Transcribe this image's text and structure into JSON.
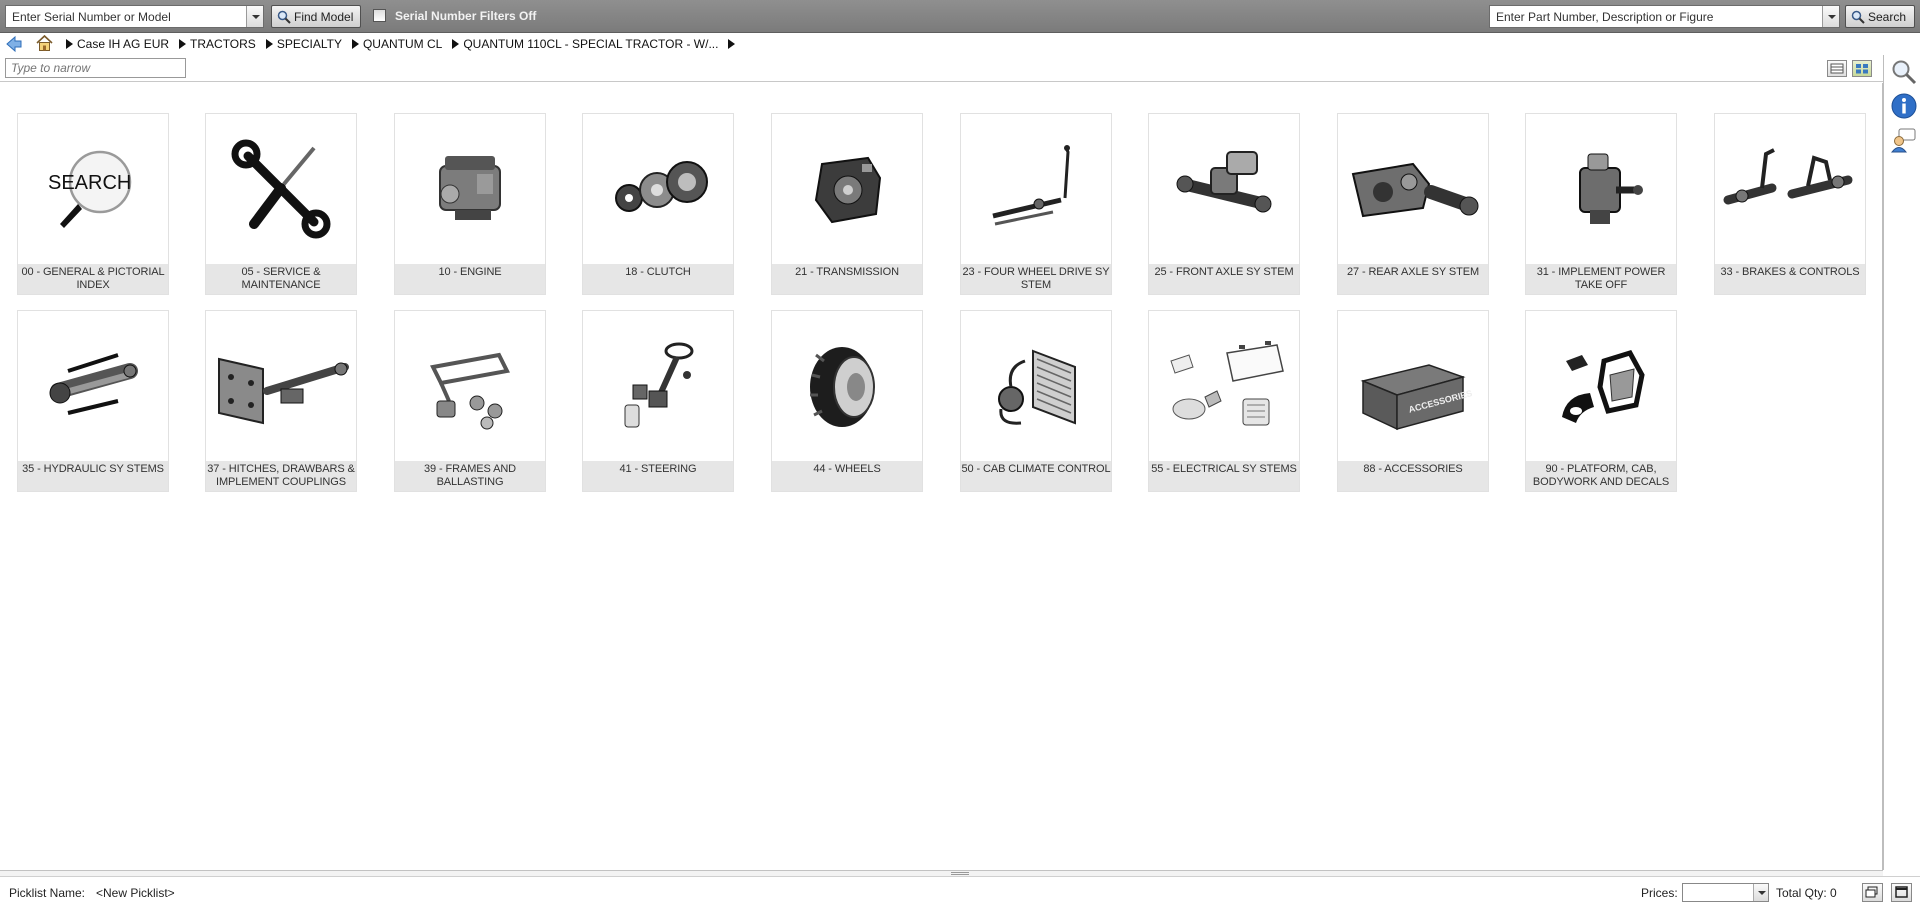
{
  "toolbar": {
    "serial_placeholder": "Enter Serial Number or Model",
    "find_model_label": "Find Model",
    "serial_filter_label": "Serial Number Filters Off",
    "part_placeholder": "Enter Part Number, Description or Figure",
    "search_label": "Search"
  },
  "breadcrumb": [
    "Case IH AG EUR",
    "TRACTORS",
    "SPECIALTY",
    "QUANTUM CL",
    "QUANTUM 110CL - SPECIAL TRACTOR - W/..."
  ],
  "narrow": {
    "placeholder": "Type to narrow"
  },
  "categories": [
    {
      "label": "00 - GENERAL & PICTORIAL INDEX",
      "icon": "search-magnifier-icon"
    },
    {
      "label": "05 - SERVICE & MAINTENANCE",
      "icon": "wrench-screwdriver-icon"
    },
    {
      "label": "10 - ENGINE",
      "icon": "engine-icon"
    },
    {
      "label": "18 - CLUTCH",
      "icon": "clutch-icon"
    },
    {
      "label": "21 - TRANSMISSION",
      "icon": "transmission-icon"
    },
    {
      "label": "23 - FOUR WHEEL DRIVE SY STEM",
      "icon": "four-wheel-drive-icon"
    },
    {
      "label": "25 - FRONT AXLE SY STEM",
      "icon": "front-axle-icon"
    },
    {
      "label": "27 - REAR AXLE SY STEM",
      "icon": "rear-axle-icon"
    },
    {
      "label": "31 - IMPLEMENT POWER TAKE OFF",
      "icon": "pto-icon"
    },
    {
      "label": "33 - BRAKES & CONTROLS",
      "icon": "brakes-icon"
    },
    {
      "label": "35 - HYDRAULIC SY STEMS",
      "icon": "hydraulic-icon"
    },
    {
      "label": "37 - HITCHES, DRAWBARS & IMPLEMENT COUPLINGS",
      "icon": "hitch-icon"
    },
    {
      "label": "39 - FRAMES AND BALLASTING",
      "icon": "frame-icon"
    },
    {
      "label": "41 - STEERING",
      "icon": "steering-icon"
    },
    {
      "label": "44 - WHEELS",
      "icon": "wheel-icon"
    },
    {
      "label": "50 - CAB CLIMATE CONTROL",
      "icon": "climate-icon"
    },
    {
      "label": "55 - ELECTRICAL SY STEMS",
      "icon": "electrical-icon"
    },
    {
      "label": "88 - ACCESSORIES",
      "icon": "accessories-crate-icon"
    },
    {
      "label": "90 - PLATFORM, CAB, BODYWORK AND DECALS",
      "icon": "cab-icon"
    }
  ],
  "search_tile_text": "SEARCH",
  "accessories_crate_text": "ACCESSORIES",
  "footer": {
    "picklist_label": "Picklist Name:",
    "picklist_value": "<New Picklist>",
    "prices_label": "Prices:",
    "total_qty": "Total Qty: 0"
  },
  "colors": {
    "toolbar_bg": "#858585",
    "tile_label_bg": "#e6e6e6",
    "info_blue": "#2f6fc7"
  }
}
